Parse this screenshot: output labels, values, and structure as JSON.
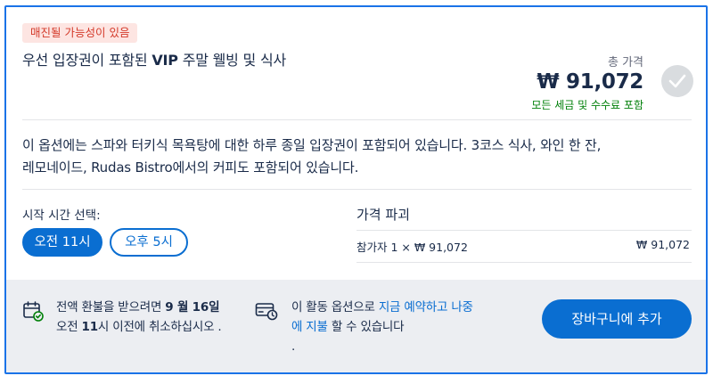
{
  "badge": "매진될 가능성이 있음",
  "title_prefix": "우선 입장권이 포함된 ",
  "title_bold": "VIP",
  "title_suffix": " 주말 웰빙 및 식사",
  "total_label": "총 가격",
  "total_price": "₩ 91,072",
  "tax_note": "모든 세금 및 수수료 포함",
  "description": "이 옵션에는 스파와 터키식 목욕탕에 대한 하루 종일 입장권이 포함되어 있습니다. 3코스 식사, 와인 한 잔, 레모네이드, Rudas Bistro에서의 커피도 포함되어 있습니다.",
  "start_time": {
    "label": "시작 시간 선택:",
    "options": [
      "오전 11시",
      "오후 5시"
    ],
    "selected": "오전 11시"
  },
  "price_breakdown": {
    "title": "가격 파괴",
    "row_label": "참가자 1 × ₩ 91,072",
    "row_value": "₩ 91,072"
  },
  "refund": {
    "prefix": "전액 환불을 받으려면 ",
    "date": "9 월 16일",
    "line2_prefix": "오전 ",
    "time": "11",
    "suffix": "시 이전에 취소하십시오 ."
  },
  "reserve": {
    "prefix": "이 활동 옵션으로 ",
    "link": "지금 예약하고 나중에 지불",
    "suffix": " 할 수 있습니다",
    "trailing": "."
  },
  "cart_button": "장바구니에 추가",
  "colors": {
    "accent": "#0a6ed1",
    "frame": "#1a73e8",
    "badge_bg": "#fde5e2",
    "badge_text": "#d43a2a",
    "success": "#008009",
    "footer_bg": "#eceef2"
  },
  "icons": {
    "check": "check-icon",
    "refund": "calendar-check-icon",
    "reserve": "card-clock-icon"
  }
}
